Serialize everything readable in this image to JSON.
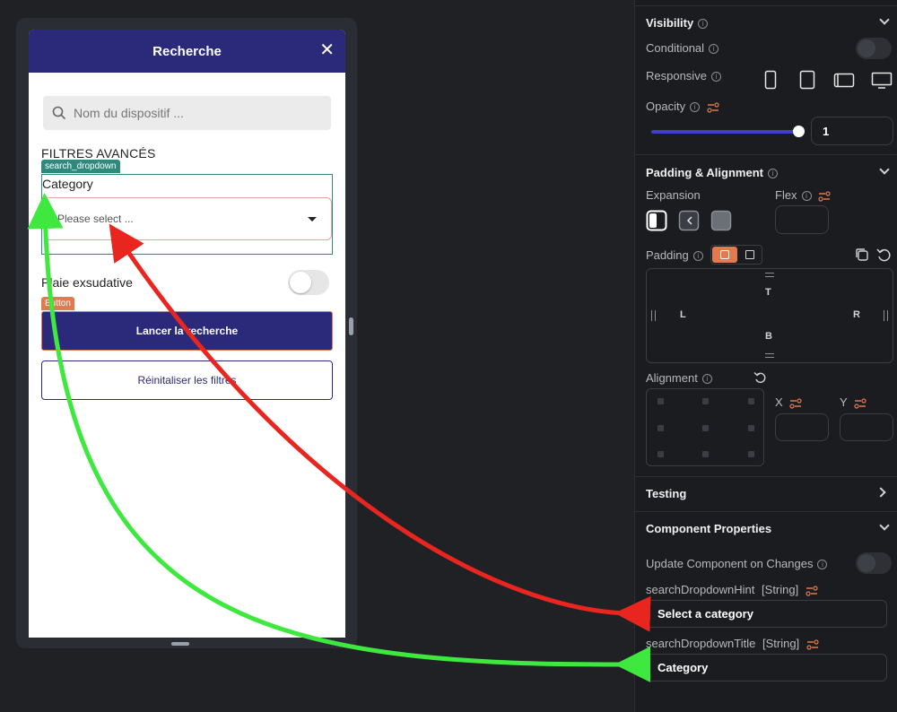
{
  "preview": {
    "appbar_title": "Recherche",
    "close_glyph": "✕",
    "search_placeholder": "Nom du dispositif ...",
    "filters_title": "FILTRES AVANCÉS",
    "dropdown_tag": "search_dropdown",
    "dropdown_title": "Category",
    "dropdown_hint": "Please select ...",
    "toggle_label": "Plaie exsudative",
    "button_tag": "Button",
    "primary_button": "Lancer la recherche",
    "secondary_button": "Réinitaliser les filtres"
  },
  "panel": {
    "visibility": {
      "header": "Visibility",
      "conditional_label": "Conditional",
      "responsive_label": "Responsive",
      "opacity_label": "Opacity",
      "opacity_value": "1",
      "opacity_level": 1
    },
    "padding_alignment": {
      "header": "Padding & Alignment",
      "expansion_label": "Expansion",
      "flex_label": "Flex",
      "padding_label": "Padding",
      "pad_t": "T",
      "pad_l": "L",
      "pad_r": "R",
      "pad_b": "B",
      "alignment_label": "Alignment",
      "x_label": "X",
      "y_label": "Y"
    },
    "testing": {
      "header": "Testing"
    },
    "component_properties": {
      "header": "Component Properties",
      "update_label": "Update Component on Changes",
      "hint_prop_label": "searchDropdownHint",
      "hint_prop_type": "[String]",
      "hint_value": "Select a category",
      "title_prop_label": "searchDropdownTitle",
      "title_prop_type": "[String]",
      "title_value": "Category"
    }
  },
  "colors": {
    "appbar": "#2b2a7a",
    "accent_orange": "#e07a4f",
    "teal_tag": "#2f8a7e",
    "arrow_red": "#e8261f",
    "arrow_green": "#3ee83e"
  }
}
